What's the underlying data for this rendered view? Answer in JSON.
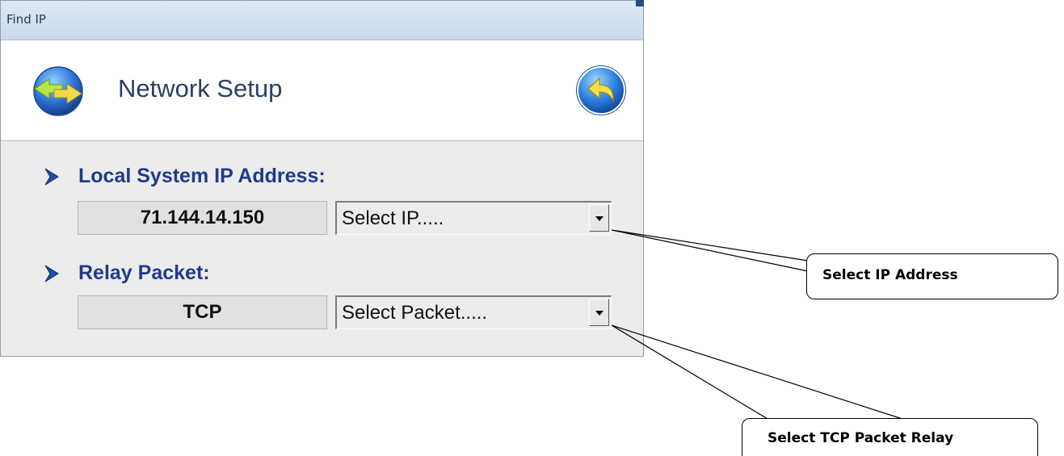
{
  "window": {
    "title": "Find IP"
  },
  "header": {
    "title": "Network Setup",
    "icon": "network-sync-icon",
    "back_icon": "back-arrow-icon"
  },
  "sections": [
    {
      "label": "Local System  IP Address:",
      "value": "71.144.14.150",
      "select_value": "Select IP....."
    },
    {
      "label": "Relay Packet:",
      "value": "TCP",
      "select_value": "Select Packet....."
    }
  ],
  "callouts": [
    {
      "text": "Select IP Address"
    },
    {
      "text": "Select TCP Packet Relay"
    }
  ],
  "colors": {
    "accent_blue": "#1f3b8a",
    "header_title": "#2b3f66",
    "titlebar": "#c9d9ec",
    "icon_green": "#b6e64a",
    "icon_blue": "#2f73d6"
  }
}
